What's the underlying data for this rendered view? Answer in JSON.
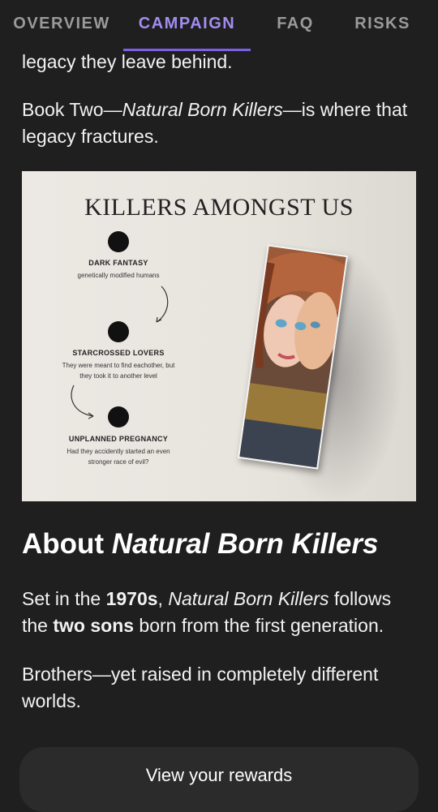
{
  "nav": {
    "tabs": [
      {
        "label": "OVERVIEW"
      },
      {
        "label": "CAMPAIGN"
      },
      {
        "label": "FAQ"
      },
      {
        "label": "RISKS"
      }
    ],
    "active_tab": "CAMPAIGN"
  },
  "content": {
    "intro_tail": "legacy they leave behind.",
    "book_two": {
      "prefix": "Book Two—",
      "title": "Natural Born Killers",
      "suffix": "—is where that legacy fractures."
    },
    "image": {
      "title": "KILLERS AMONGST US",
      "steps": [
        {
          "title": "DARK FANTASY",
          "desc": "genetically modified humans"
        },
        {
          "title": "STARCROSSED LOVERS",
          "desc": "They were meant to find eachother, but they took it to another level"
        },
        {
          "title": "UNPLANNED PREGNANCY",
          "desc": "Had they accidently started an even stronger race of evil?"
        }
      ]
    },
    "about": {
      "prefix": "About ",
      "title": "Natural Born Killers"
    },
    "para1": {
      "a": "Set in the ",
      "b": "1970s",
      "c": ", ",
      "d": "Natural Born Killers",
      "e": " follows the ",
      "f": "two sons",
      "g": " born from the first generation."
    },
    "para2": "Brothers—yet raised in completely different worlds."
  },
  "bottom": {
    "button_label": "View your rewards"
  },
  "colors": {
    "background": "#1f1f1f",
    "accent": "#a38cf0",
    "indicator": "#7a61e6"
  }
}
